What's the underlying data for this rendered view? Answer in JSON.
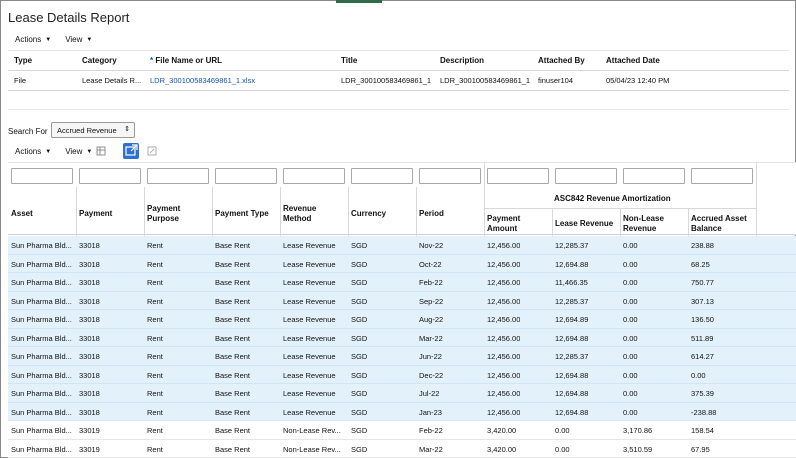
{
  "page": {
    "title": "Lease Details Report"
  },
  "menu1": {
    "actions": "Actions",
    "view": "View"
  },
  "attachments": {
    "headers": {
      "type": "Type",
      "category": "Category",
      "file_required": "*",
      "file": "File Name or URL",
      "title": "Title",
      "description": "Description",
      "attached_by": "Attached By",
      "attached_date": "Attached Date"
    },
    "row": {
      "type": "File",
      "category": "Lease Details R...",
      "file": "LDR_300100583469861_1.xlsx",
      "title": "LDR_300100583469861_1",
      "description": "LDR_300100583469861_1",
      "attached_by": "finuser104",
      "attached_date": "05/04/23 12:40 PM"
    }
  },
  "search": {
    "label": "Search For",
    "value": "Accrued Revenue"
  },
  "menu2": {
    "actions": "Actions",
    "view": "View"
  },
  "grid": {
    "group_header": "ASC842 Revenue Amortization",
    "headers": {
      "asset": "Asset",
      "payment": "Payment",
      "purpose": "Payment Purpose",
      "ptype": "Payment Type",
      "method": "Revenue Method",
      "currency": "Currency",
      "period": "Period",
      "amount": "Payment Amount",
      "lease_rev": "Lease Revenue",
      "nonlease_rev": "Non-Lease Revenue",
      "balance": "Accrued Asset Balance"
    },
    "rows": [
      {
        "asset": "Sun Pharma Bld...",
        "payment": "33018",
        "purpose": "Rent",
        "ptype": "Base Rent",
        "method": "Lease Revenue",
        "currency": "SGD",
        "period": "Nov-22",
        "amount": "12,456.00",
        "lease": "12,285.37",
        "nonlease": "0.00",
        "balance": "238.88",
        "selected": true
      },
      {
        "asset": "Sun Pharma Bld...",
        "payment": "33018",
        "purpose": "Rent",
        "ptype": "Base Rent",
        "method": "Lease Revenue",
        "currency": "SGD",
        "period": "Oct-22",
        "amount": "12,456.00",
        "lease": "12,694.88",
        "nonlease": "0.00",
        "balance": "68.25",
        "selected": true
      },
      {
        "asset": "Sun Pharma Bld...",
        "payment": "33018",
        "purpose": "Rent",
        "ptype": "Base Rent",
        "method": "Lease Revenue",
        "currency": "SGD",
        "period": "Feb-22",
        "amount": "12,456.00",
        "lease": "11,466.35",
        "nonlease": "0.00",
        "balance": "750.77",
        "selected": true
      },
      {
        "asset": "Sun Pharma Bld...",
        "payment": "33018",
        "purpose": "Rent",
        "ptype": "Base Rent",
        "method": "Lease Revenue",
        "currency": "SGD",
        "period": "Sep-22",
        "amount": "12,456.00",
        "lease": "12,285.37",
        "nonlease": "0.00",
        "balance": "307.13",
        "selected": true
      },
      {
        "asset": "Sun Pharma Bld...",
        "payment": "33018",
        "purpose": "Rent",
        "ptype": "Base Rent",
        "method": "Lease Revenue",
        "currency": "SGD",
        "period": "Aug-22",
        "amount": "12,456.00",
        "lease": "12,694.89",
        "nonlease": "0.00",
        "balance": "136.50",
        "selected": true
      },
      {
        "asset": "Sun Pharma Bld...",
        "payment": "33018",
        "purpose": "Rent",
        "ptype": "Base Rent",
        "method": "Lease Revenue",
        "currency": "SGD",
        "period": "Mar-22",
        "amount": "12,456.00",
        "lease": "12,694.88",
        "nonlease": "0.00",
        "balance": "511.89",
        "selected": true
      },
      {
        "asset": "Sun Pharma Bld...",
        "payment": "33018",
        "purpose": "Rent",
        "ptype": "Base Rent",
        "method": "Lease Revenue",
        "currency": "SGD",
        "period": "Jun-22",
        "amount": "12,456.00",
        "lease": "12,285.37",
        "nonlease": "0.00",
        "balance": "614.27",
        "selected": true
      },
      {
        "asset": "Sun Pharma Bld...",
        "payment": "33018",
        "purpose": "Rent",
        "ptype": "Base Rent",
        "method": "Lease Revenue",
        "currency": "SGD",
        "period": "Dec-22",
        "amount": "12,456.00",
        "lease": "12,694.88",
        "nonlease": "0.00",
        "balance": "0.00",
        "selected": true
      },
      {
        "asset": "Sun Pharma Bld...",
        "payment": "33018",
        "purpose": "Rent",
        "ptype": "Base Rent",
        "method": "Lease Revenue",
        "currency": "SGD",
        "period": "Jul-22",
        "amount": "12,456.00",
        "lease": "12,694.88",
        "nonlease": "0.00",
        "balance": "375.39",
        "selected": true
      },
      {
        "asset": "Sun Pharma Bld...",
        "payment": "33018",
        "purpose": "Rent",
        "ptype": "Base Rent",
        "method": "Lease Revenue",
        "currency": "SGD",
        "period": "Jan-23",
        "amount": "12,456.00",
        "lease": "12,694.88",
        "nonlease": "0.00",
        "balance": "-238.88",
        "selected": true
      },
      {
        "asset": "Sun Pharma Bld...",
        "payment": "33019",
        "purpose": "Rent",
        "ptype": "Base Rent",
        "method": "Non-Lease Rev...",
        "currency": "SGD",
        "period": "Feb-22",
        "amount": "3,420.00",
        "lease": "0.00",
        "nonlease": "3,170.86",
        "balance": "158.54",
        "selected": false
      },
      {
        "asset": "Sun Pharma Bld...",
        "payment": "33019",
        "purpose": "Rent",
        "ptype": "Base Rent",
        "method": "Non-Lease Rev...",
        "currency": "SGD",
        "period": "Mar-22",
        "amount": "3,420.00",
        "lease": "0.00",
        "nonlease": "3,510.59",
        "balance": "67.95",
        "selected": false
      }
    ]
  },
  "colors": {
    "selected_row": "#e3f1fb",
    "accent": "#2f6fcf",
    "link": "#1155aa"
  },
  "icons": [
    "freeze-icon",
    "detach-icon",
    "wrap-icon"
  ]
}
